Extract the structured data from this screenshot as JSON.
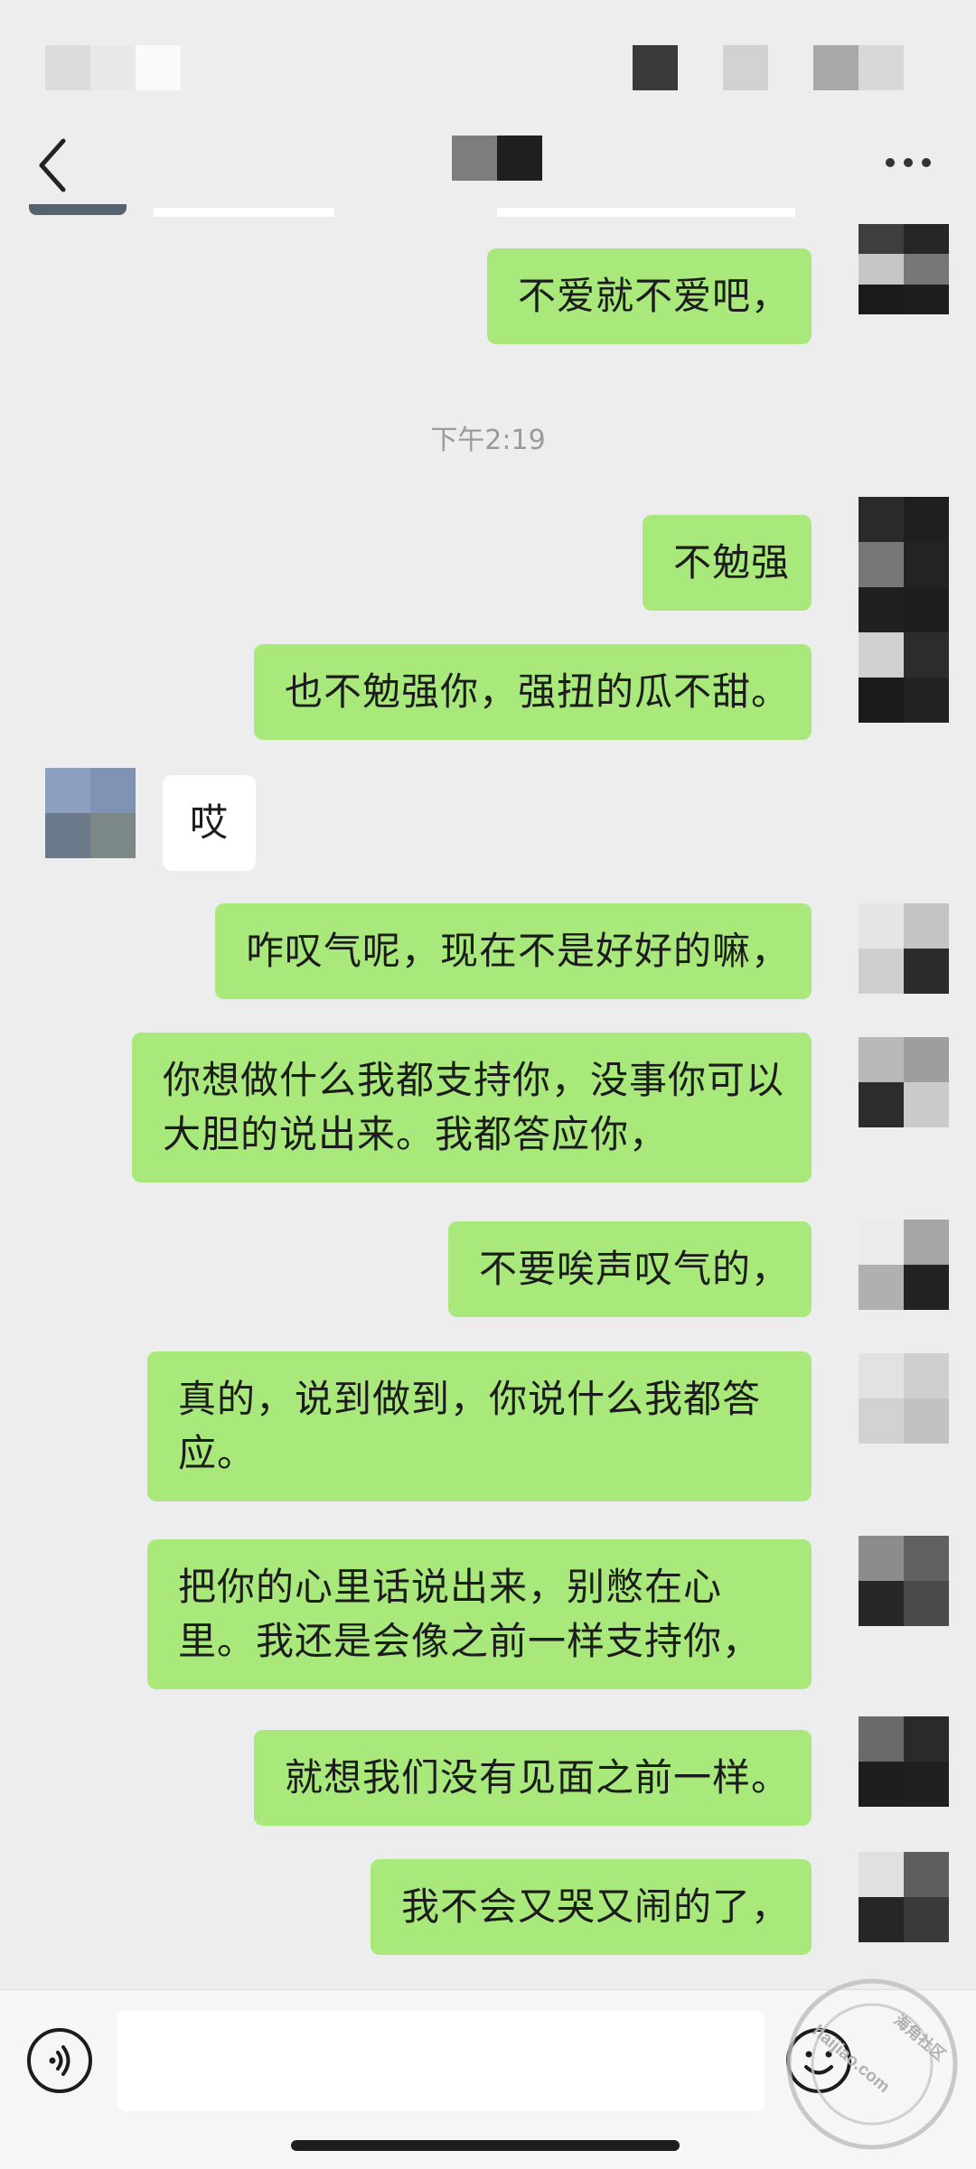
{
  "colors": {
    "background": "#ededed",
    "sent_bubble": "#a9e97b",
    "received_bubble": "#ffffff",
    "timestamp_text": "#9a9a9a"
  },
  "header": {
    "back_icon": "chevron-left-icon",
    "more_icon": "ellipsis-icon"
  },
  "chat": {
    "timestamp": "下午2:19",
    "messages": [
      {
        "side": "right",
        "text": "不爱就不爱吧，"
      },
      {
        "side": "right",
        "text": "不勉强"
      },
      {
        "side": "right",
        "text": "也不勉强你，强扭的瓜不甜。"
      },
      {
        "side": "left",
        "text": "哎"
      },
      {
        "side": "right",
        "text": "咋叹气呢，现在不是好好的嘛，"
      },
      {
        "side": "right",
        "text": "你想做什么我都支持你，没事你可以大胆的说出来。我都答应你，"
      },
      {
        "side": "right",
        "text": "不要唉声叹气的，"
      },
      {
        "side": "right",
        "text": "真的，说到做到，你说什么我都答应。"
      },
      {
        "side": "right",
        "text": "把你的心里话说出来，别憋在心里。我还是会像之前一样支持你，"
      },
      {
        "side": "right",
        "text": "就想我们没有见面之前一样。"
      },
      {
        "side": "right",
        "text": "我不会又哭又闹的了，"
      }
    ]
  },
  "input_bar": {
    "voice_icon": "voice-icon",
    "emoji_icon": "emoji-icon",
    "input_value": ""
  },
  "watermark": {
    "text_1": "海角社区",
    "text_2": "haijiao.com"
  }
}
